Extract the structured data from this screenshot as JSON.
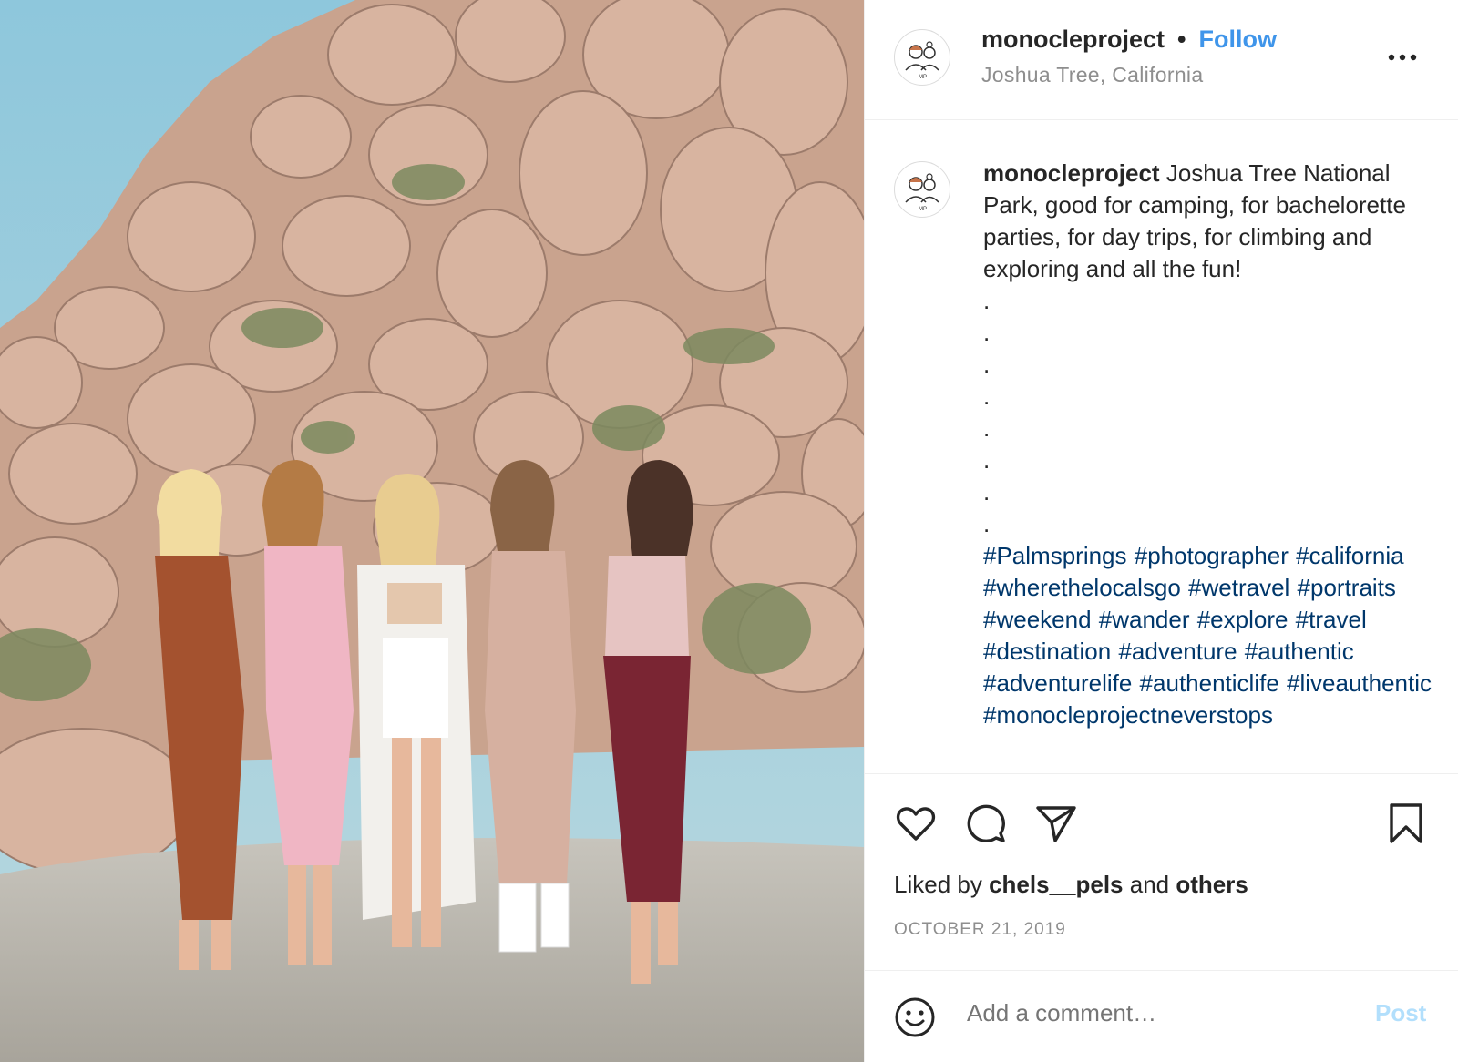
{
  "post": {
    "username": "monocleproject",
    "follow_label": "Follow",
    "location": "Joshua Tree, California",
    "photo_alt": "",
    "caption": {
      "username": "monocleproject",
      "text": "Joshua Tree National Park, good for camping, for bachelorette parties, for day trips, for climbing and exploring and all the fun!",
      "dots": [
        ".",
        ".",
        ".",
        ".",
        ".",
        ".",
        ".",
        "."
      ],
      "hashtags": "#Palmsprings #photographer #california #wherethelocalsgo #wetravel #portraits #weekend #wander #explore #travel #destination #adventure #authentic #adventurelife #authenticlife #liveauthentic #monocleprojectneverstops"
    },
    "actions": {
      "like_icon": "heart-icon",
      "comment_icon": "comment-icon",
      "share_icon": "share-icon",
      "save_icon": "bookmark-icon"
    },
    "likes": {
      "prefix": "Liked by",
      "user": "chels__pels",
      "connector": "and",
      "others": "others"
    },
    "date": "OCTOBER 21, 2019",
    "comment": {
      "placeholder": "Add a comment…",
      "post_label": "Post",
      "emoji_icon": "smiley-icon"
    },
    "more_icon": "more-options-icon",
    "colors": {
      "follow": "#3f95ea",
      "hashtag": "#00376b",
      "muted": "#8e8e8e",
      "post_disabled": "#b2dffc"
    }
  }
}
